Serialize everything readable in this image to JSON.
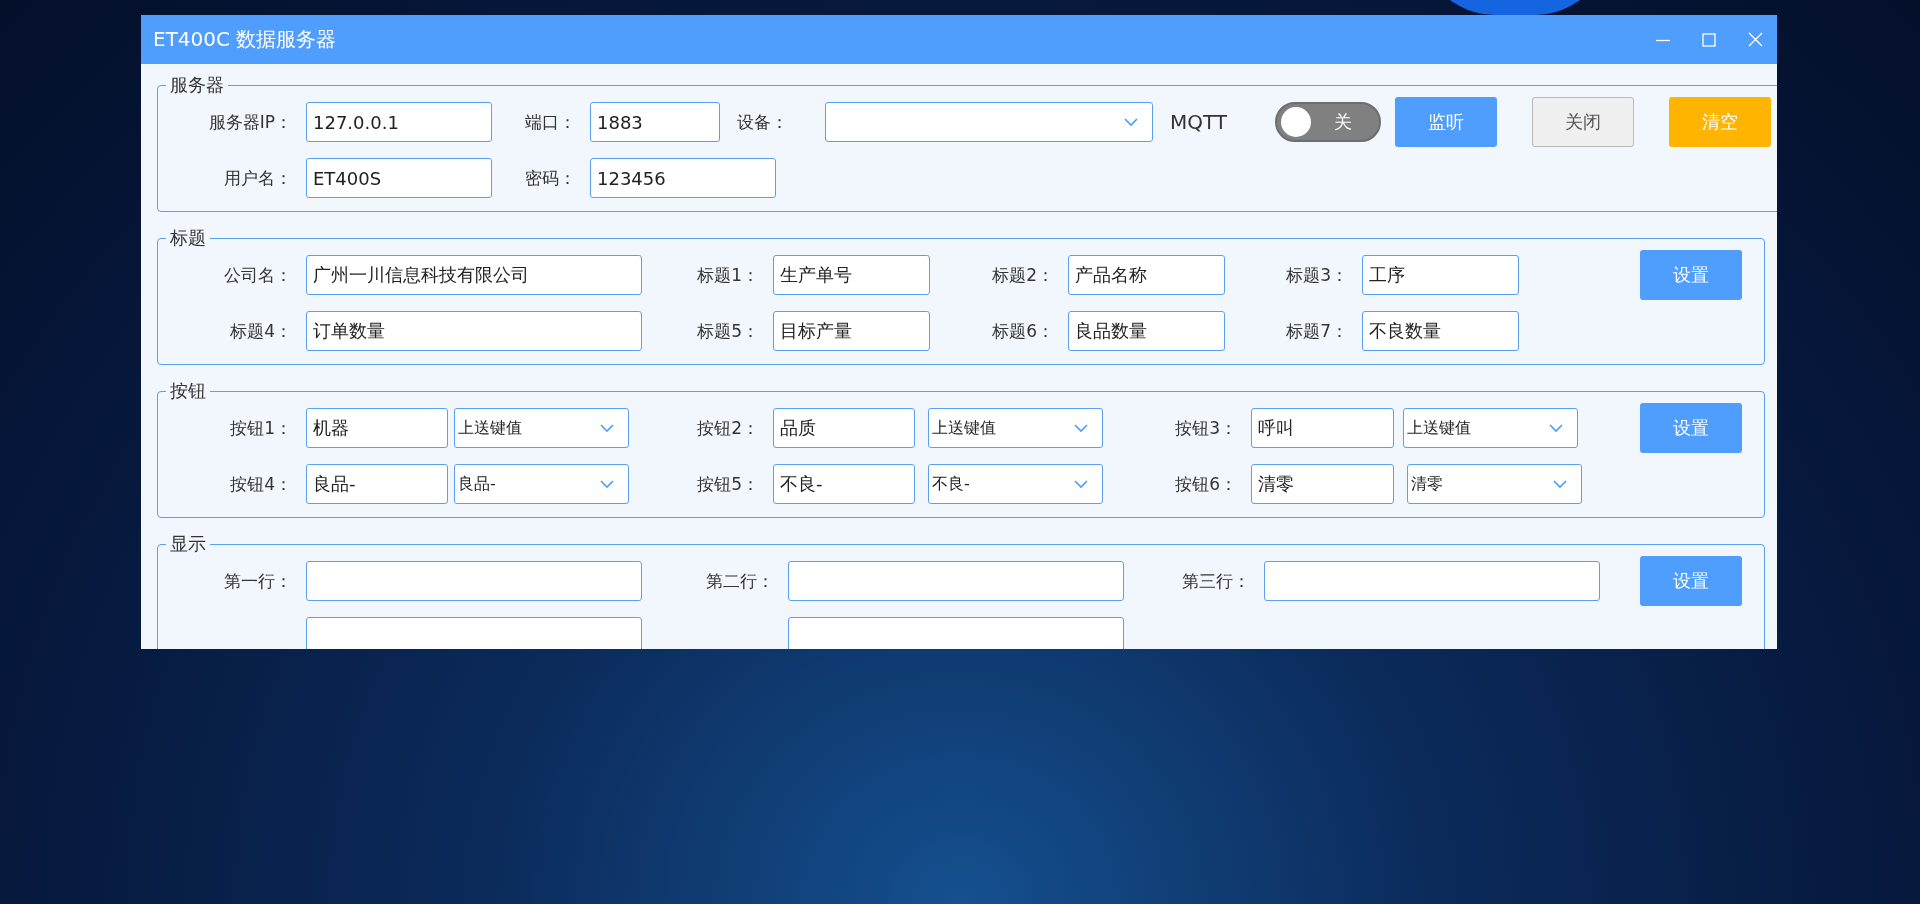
{
  "window": {
    "title": "ET400C 数据服务器"
  },
  "sections": [
    {
      "legend": "服务器",
      "rows": [
        [
          {
            "kind": "label",
            "text": "服务器IP："
          },
          {
            "kind": "field",
            "value": "127.0.0.1"
          },
          {
            "kind": "label",
            "text": "端口："
          },
          {
            "kind": "field",
            "value": "1883"
          },
          {
            "kind": "label",
            "text": "设备："
          },
          {
            "kind": "select"
          },
          {
            "kind": "text",
            "text": "MQTT"
          },
          {
            "kind": "toggle",
            "on": false,
            "label": "关"
          },
          {
            "kind": "primary_button",
            "label": "监听"
          },
          {
            "kind": "plain_button",
            "label": "关闭"
          },
          {
            "kind": "warning_button",
            "label": "清空"
          }
        ],
        [
          {
            "kind": "label",
            "text": "用户名："
          },
          {
            "kind": "field",
            "value": "ET400S"
          },
          {
            "kind": "label",
            "text": "密码："
          },
          {
            "kind": "field",
            "value": "123456"
          }
        ]
      ]
    },
    {
      "legend": "标题",
      "rows": [
        [
          {
            "kind": "label",
            "text": "公司名："
          },
          {
            "kind": "field",
            "value": "广州一川信息科技有限公司"
          },
          {
            "kind": "label",
            "text": "标题1："
          },
          {
            "kind": "field",
            "value": "生产单号"
          },
          {
            "kind": "label",
            "text": "标题2："
          },
          {
            "kind": "field",
            "value": "产品名称"
          },
          {
            "kind": "label",
            "text": "标题3："
          },
          {
            "kind": "field",
            "value": "工序"
          },
          {
            "kind": "primary_button",
            "label": "设置"
          }
        ],
        [
          {
            "kind": "label",
            "text": "标题4："
          },
          {
            "kind": "field",
            "value": "订单数量"
          },
          {
            "kind": "label",
            "text": "标题5："
          },
          {
            "kind": "field",
            "value": "目标产量"
          },
          {
            "kind": "label",
            "text": "标题6："
          },
          {
            "kind": "field",
            "value": "良品数量"
          },
          {
            "kind": "label",
            "text": "标题7："
          },
          {
            "kind": "field",
            "value": "不良数量"
          }
        ]
      ]
    },
    {
      "legend": "按钮",
      "rows": [
        [
          {
            "kind": "label",
            "text": "按钮1："
          },
          {
            "kind": "field",
            "value": "机器"
          },
          {
            "kind": "select",
            "value": "上送键值"
          },
          {
            "kind": "label",
            "text": "按钮2："
          },
          {
            "kind": "field",
            "value": "品质"
          },
          {
            "kind": "select",
            "value": "上送键值"
          },
          {
            "kind": "label",
            "text": "按钮3："
          },
          {
            "kind": "field",
            "value": "呼叫"
          },
          {
            "kind": "select",
            "value": "上送键值"
          },
          {
            "kind": "primary_button",
            "label": "设置"
          }
        ],
        [
          {
            "kind": "label",
            "text": "按钮4："
          },
          {
            "kind": "field",
            "value": "良品-"
          },
          {
            "kind": "select",
            "value": "良品-"
          },
          {
            "kind": "label",
            "text": "按钮5："
          },
          {
            "kind": "field",
            "value": "不良-"
          },
          {
            "kind": "select",
            "value": "不良-"
          },
          {
            "kind": "label",
            "text": "按钮6："
          },
          {
            "kind": "field",
            "value": "清零"
          },
          {
            "kind": "select",
            "value": "清零"
          }
        ]
      ]
    },
    {
      "legend": "显示",
      "rows": [
        [
          {
            "kind": "label",
            "text": "第一行："
          },
          {
            "kind": "field"
          },
          {
            "kind": "label",
            "text": "第二行："
          },
          {
            "kind": "field"
          },
          {
            "kind": "label",
            "text": "第三行："
          },
          {
            "kind": "field"
          },
          {
            "kind": "primary_button",
            "label": "设置"
          }
        ],
        [
          {
            "kind": "field"
          },
          {
            "kind": "field"
          }
        ]
      ]
    }
  ]
}
